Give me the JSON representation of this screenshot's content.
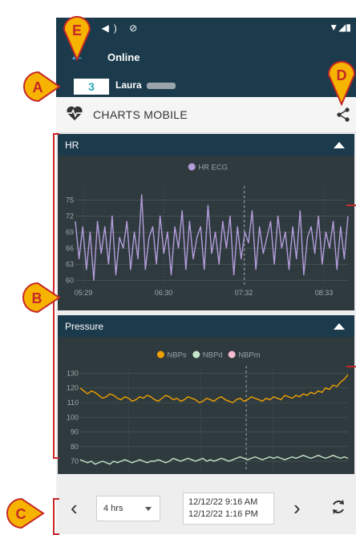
{
  "app": {
    "status_icons": "◑ ◀) ⊘",
    "status_right": "▼◢▮",
    "back_icon": "←",
    "title": "Online",
    "bed_number": "3",
    "patient_name": "Laura",
    "module_title": "CHARTS MOBILE"
  },
  "callouts": {
    "a": "A",
    "b": "B",
    "c": "C",
    "d": "D",
    "e": "E"
  },
  "colors": {
    "header": "#1b3a4b",
    "panel": "#2f3a3e",
    "hr": "#b39ddb",
    "nbps": "#f0a000",
    "nbpd": "#c8e6c9",
    "nbpm": "#f8bbd0",
    "callout": "#f6b400",
    "callout_border": "#c62828"
  },
  "bottom_bar": {
    "range": "4 hrs",
    "date_from": "12/12/22 9:16 AM",
    "date_to": "12/12/22 1:16 PM"
  },
  "chart_data": [
    {
      "type": "line",
      "title": "HR",
      "series": [
        {
          "name": "HR ECG",
          "color": "#b39ddb",
          "values": [
            71,
            64,
            70,
            62,
            69,
            60,
            71,
            65,
            70,
            63,
            72,
            61,
            68,
            66,
            71,
            62,
            69,
            64,
            76,
            62,
            68,
            70,
            63,
            72,
            65,
            69,
            61,
            70,
            66,
            73,
            62,
            71,
            64,
            68,
            70,
            62,
            74,
            65,
            69,
            63,
            71,
            66,
            72,
            61,
            70,
            64,
            69,
            67,
            73,
            62,
            70,
            65,
            68,
            71,
            63,
            72,
            66,
            69,
            62,
            70,
            64,
            73,
            61,
            68,
            70,
            65,
            72,
            63,
            69,
            66,
            71,
            62,
            70,
            64,
            72
          ]
        }
      ],
      "x_tick_labels": [
        "05:29",
        "06:30",
        "07:32",
        "08:33"
      ],
      "y_tick_labels": [
        75,
        72,
        69,
        66,
        63,
        60
      ],
      "ylim": [
        59,
        77
      ],
      "grid": true,
      "legend": "top"
    },
    {
      "type": "line",
      "title": "Pressure",
      "series": [
        {
          "name": "NBPs",
          "color": "#f0a000",
          "values": [
            120,
            118,
            116,
            118,
            117,
            115,
            113,
            114,
            116,
            115,
            113,
            112,
            114,
            113,
            111,
            112,
            114,
            113,
            115,
            114,
            112,
            111,
            113,
            115,
            114,
            112,
            113,
            111,
            112,
            114,
            113,
            112,
            110,
            111,
            113,
            112,
            111,
            113,
            114,
            112,
            111,
            110,
            112,
            113,
            111,
            112,
            114,
            113,
            112,
            111,
            113,
            112,
            114,
            113,
            112,
            115,
            114,
            113,
            115,
            114,
            116,
            115,
            117,
            116,
            118,
            117,
            120,
            119,
            122,
            121,
            124,
            126,
            129
          ]
        },
        {
          "name": "NBPd",
          "color": "#c8e6c9",
          "values": [
            71,
            70,
            69,
            70,
            68,
            69,
            70,
            69,
            68,
            70,
            69,
            70,
            71,
            70,
            69,
            70,
            71,
            70,
            69,
            70,
            70,
            71,
            70,
            69,
            70,
            72,
            71,
            70,
            71,
            72,
            71,
            70,
            71,
            72,
            70,
            71,
            70,
            71,
            72,
            71,
            70,
            71,
            72,
            73,
            72,
            71,
            72,
            73,
            72,
            71,
            72,
            73,
            72,
            73,
            72,
            71,
            72,
            73,
            72,
            73,
            74,
            73,
            72,
            73,
            74,
            73,
            72,
            73,
            74,
            73,
            72,
            73,
            72
          ]
        },
        {
          "name": "NBPm",
          "color": "#f8bbd0",
          "values": []
        }
      ],
      "y_tick_labels": [
        130,
        120,
        110,
        100,
        90,
        80,
        70
      ],
      "ylim": [
        64,
        133
      ],
      "grid": true,
      "legend": "top"
    }
  ]
}
